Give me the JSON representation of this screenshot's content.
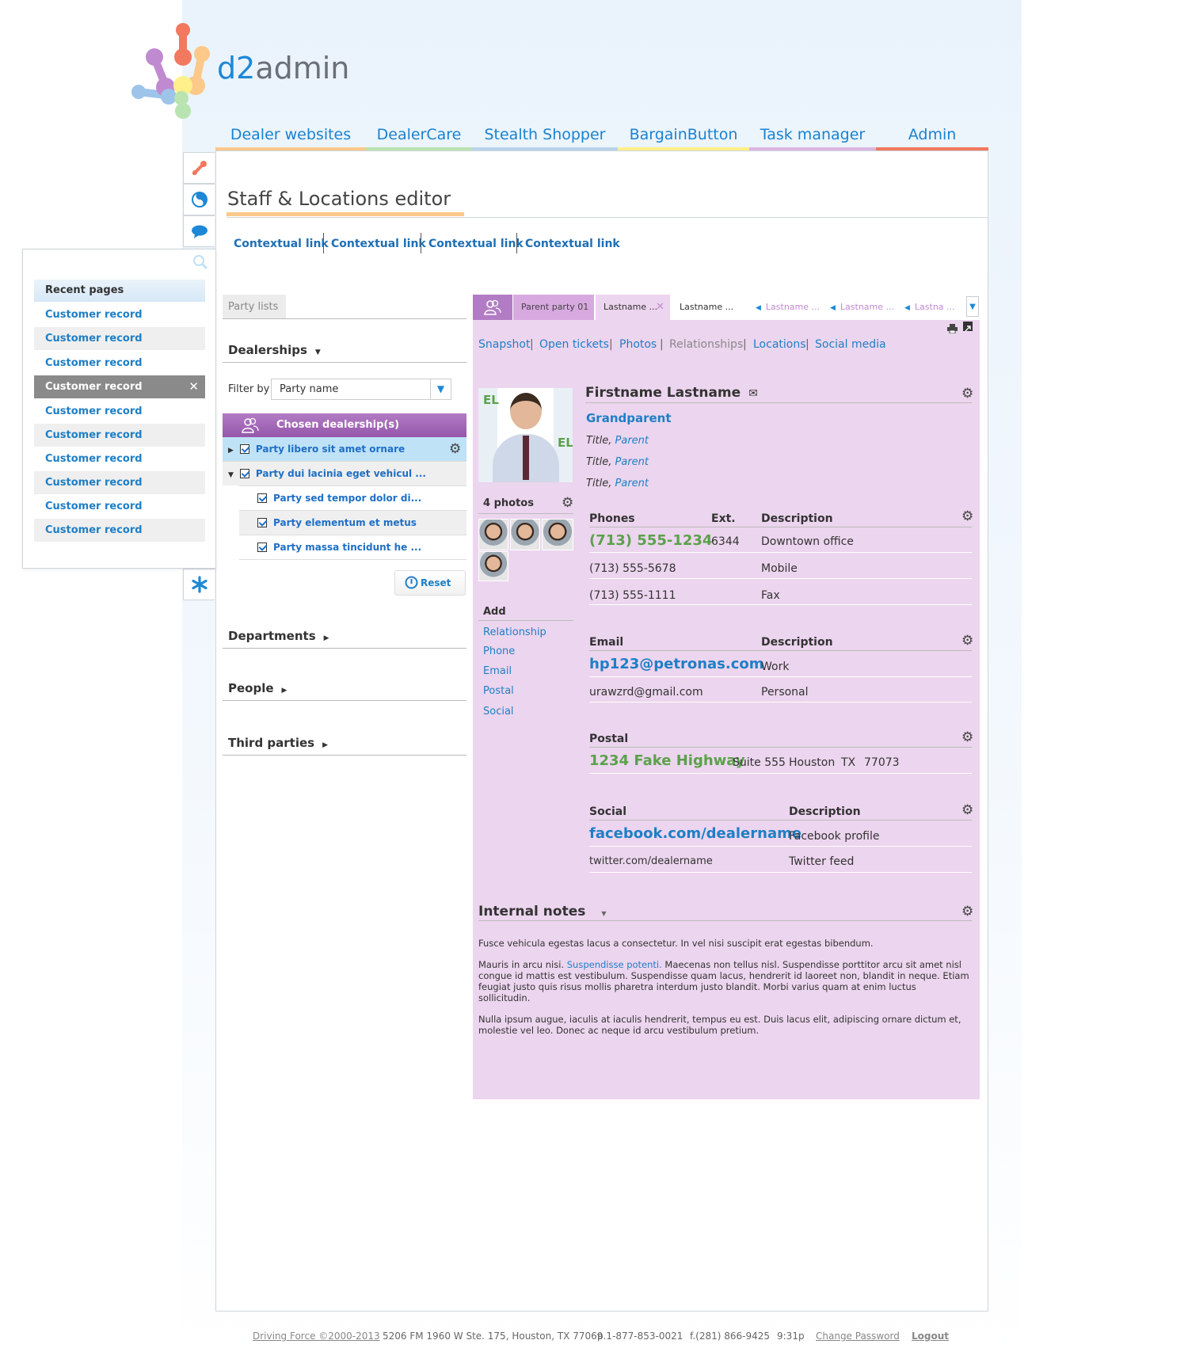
{
  "logo": {
    "brand": "d2",
    "name": "admin"
  },
  "nav": [
    {
      "label": "Dealer websites",
      "color": "#fcc98a"
    },
    {
      "label": "DealerCare",
      "color": "#b9e3b0"
    },
    {
      "label": "Stealth Shopper",
      "color": "#b9d4ec"
    },
    {
      "label": "BargainButton",
      "color": "#fff08a"
    },
    {
      "label": "Task manager",
      "color": "#d9b6e0"
    },
    {
      "label": "Admin",
      "color": "#f2785e"
    }
  ],
  "recent": {
    "heading": "Recent pages",
    "items": [
      "Customer record",
      "Customer record",
      "Customer record",
      "Customer record",
      "Customer record",
      "Customer record",
      "Customer record",
      "Customer record",
      "Customer record",
      "Customer record"
    ],
    "close_glyph": "✕"
  },
  "page": {
    "title": "Staff & Locations editor"
  },
  "contextual_links": [
    "Contextual link",
    "Contextual link",
    "Contextual link",
    "Contextual link"
  ],
  "left": {
    "party_lists_tab": "Party lists",
    "dealerships": "Dealerships",
    "filter_label": "Filter by",
    "filter_value": "Party name",
    "chosen_header": "Chosen dealership(s)",
    "rows": [
      "Party libero sit amet ornare",
      "Party dui lacinia eget vehicul ...",
      "Party sed tempor dolor di...",
      "Party elementum et metus",
      "Party massa tincidunt he ..."
    ],
    "reset": "Reset",
    "departments": "Departments",
    "people": "People",
    "third_parties": "Third parties"
  },
  "tabs": [
    "Parent party 01",
    "Lastname ...",
    "Lastname ...",
    "Lastname ...",
    "Lastname ...",
    "Lastna ..."
  ],
  "subnav": [
    "Snapshot",
    "Open tickets",
    "Photos",
    "Relationships",
    "Locations",
    "Social media"
  ],
  "record": {
    "name": "Firstname Lastname",
    "grandparent": "Grandparent",
    "titles": [
      {
        "t": "Title, ",
        "p": "Parent"
      },
      {
        "t": "Title, ",
        "p": "Parent"
      },
      {
        "t": "Title, ",
        "p": "Parent"
      }
    ],
    "photos_label": "4 photos",
    "add_label": "Add",
    "add_items": [
      "Relationship",
      "Phone",
      "Email",
      "Postal",
      "Social"
    ],
    "phones": {
      "headers": [
        "Phones",
        "Ext.",
        "Description"
      ],
      "rows": [
        [
          "(713) 555-1234",
          "6344",
          "Downtown office"
        ],
        [
          "(713) 555-5678",
          "",
          "Mobile"
        ],
        [
          "(713) 555-1111",
          "",
          "Fax"
        ]
      ]
    },
    "email": {
      "headers": [
        "Email",
        "Description"
      ],
      "rows": [
        [
          "hp123@petronas.com",
          "Work"
        ],
        [
          "urawzrd@gmail.com",
          "Personal"
        ]
      ]
    },
    "postal": {
      "header": "Postal",
      "street": "1234 Fake Highway",
      "suite": "Suite 555",
      "city": "Houston",
      "state": "TX",
      "zip": "77073"
    },
    "social": {
      "headers": [
        "Social",
        "Description"
      ],
      "rows": [
        [
          "facebook.com/dealername",
          "Facebook profile"
        ],
        [
          "twitter.com/dealername",
          "Twitter feed"
        ]
      ]
    },
    "notes": {
      "header": "Internal notes",
      "p1": "Fusce vehicula egestas lacus a consectetur. In vel nisi suscipit erat egestas bibendum.",
      "p2a": "Mauris in arcu nisi. ",
      "p2link": "Suspendisse potenti.",
      "p2b": " Maecenas non tellus nisl. Suspendisse porttitor arcu sit amet nisl congue id mattis est vestibulum. Suspendisse quam lacus, hendrerit id laoreet non, blandit in neque. Etiam feugiat justo quis risus mollis pharetra interdum justo blandit. Morbi varius quam at enim luctus sollicitudin.",
      "p3": "Nulla ipsum augue, iaculis at iaculis hendrerit, tempus eu est. Duis lacus elit, adipiscing ornare dictum et, molestie vel leo. Donec ac neque id arcu vestibulum pretium."
    }
  },
  "footer": {
    "copyright": "Driving Force ©2000-2013",
    "address": "5206 FM 1960 W Ste. 175, Houston, TX 77069",
    "phone": "p.1-877-853-0021",
    "fax": "f.(281) 866-9425",
    "time": "9:31p",
    "change_password": "Change Password",
    "logout": "Logout"
  }
}
